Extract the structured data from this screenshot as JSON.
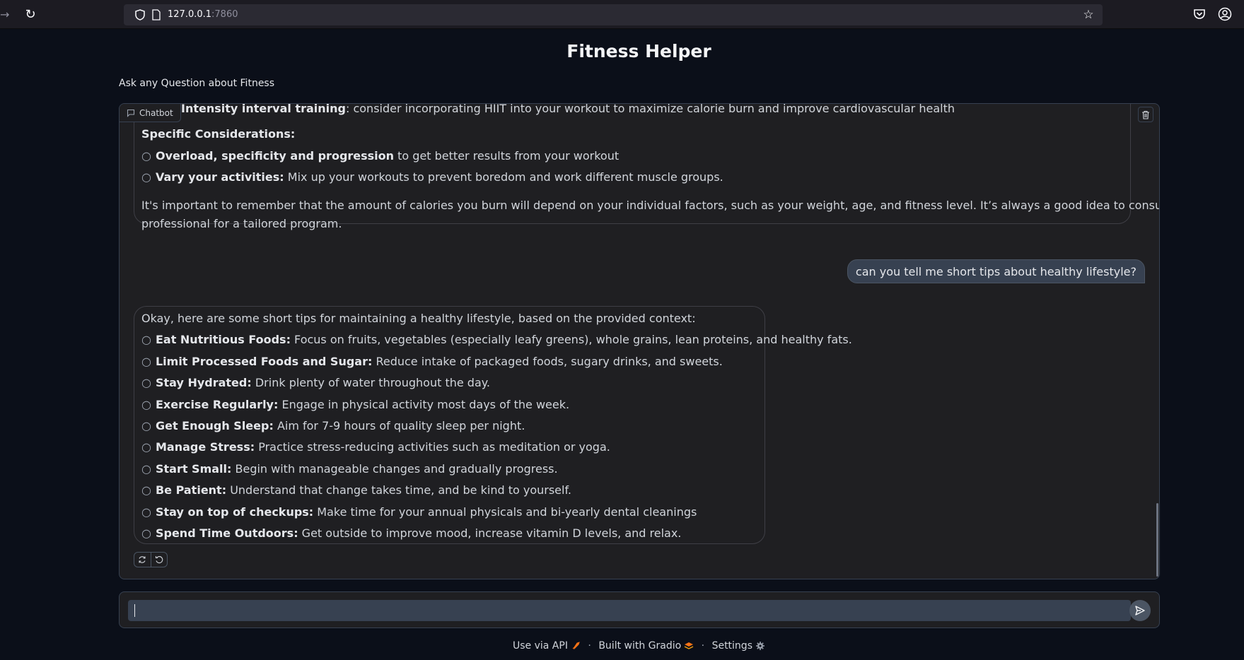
{
  "browser": {
    "url_host": "127.0.0.1",
    "url_port": ":7860"
  },
  "app": {
    "title": "Fitness Helper",
    "description": "Ask any Question about Fitness"
  },
  "chatbot": {
    "label": "Chatbot",
    "messages": [
      {
        "role": "bot",
        "partial_line": {
          "bold": "Intensity interval training",
          "text": ": consider incorporating HIIT into your workout to maximize calorie burn and improve cardiovascular health"
        },
        "heading": "Specific Considerations:",
        "items": [
          {
            "bold": "Overload, specificity and progression",
            "text": " to get better results from your workout"
          },
          {
            "bold": "Vary your activities:",
            "text": " Mix up your workouts to prevent boredom and work different muscle groups."
          }
        ],
        "closing_1": "It's important to remember that the amount of calories you burn will depend on your individual factors, such as your weight, age, and fitness level. It’s always a good idea to consult a fitness",
        "closing_2": "professional for a tailored program."
      },
      {
        "role": "user",
        "text": "can you tell me short tips about healthy lifestyle?"
      },
      {
        "role": "bot",
        "intro": "Okay, here are some short tips for maintaining a healthy lifestyle, based on the provided context:",
        "items": [
          {
            "bold": "Eat Nutritious Foods:",
            "text": " Focus on fruits, vegetables (especially leafy greens), whole grains, lean proteins, and healthy fats."
          },
          {
            "bold": "Limit Processed Foods and Sugar:",
            "text": " Reduce intake of packaged foods, sugary drinks, and sweets."
          },
          {
            "bold": "Stay Hydrated:",
            "text": " Drink plenty of water throughout the day."
          },
          {
            "bold": "Exercise Regularly:",
            "text": " Engage in physical activity most days of the week."
          },
          {
            "bold": "Get Enough Sleep:",
            "text": " Aim for 7-9 hours of quality sleep per night."
          },
          {
            "bold": "Manage Stress:",
            "text": " Practice stress-reducing activities such as meditation or yoga."
          },
          {
            "bold": "Start Small:",
            "text": " Begin with manageable changes and gradually progress."
          },
          {
            "bold": "Be Patient:",
            "text": " Understand that change takes time, and be kind to yourself."
          },
          {
            "bold": "Stay on top of checkups:",
            "text": " Make time for your annual physicals and bi-yearly dental cleanings"
          },
          {
            "bold": "Spend Time Outdoors:",
            "text": " Get outside to improve mood, increase vitamin D levels, and relax."
          }
        ]
      }
    ]
  },
  "input": {
    "value": ""
  },
  "footer": {
    "api": "Use via API",
    "built": "Built with Gradio",
    "settings": "Settings"
  }
}
